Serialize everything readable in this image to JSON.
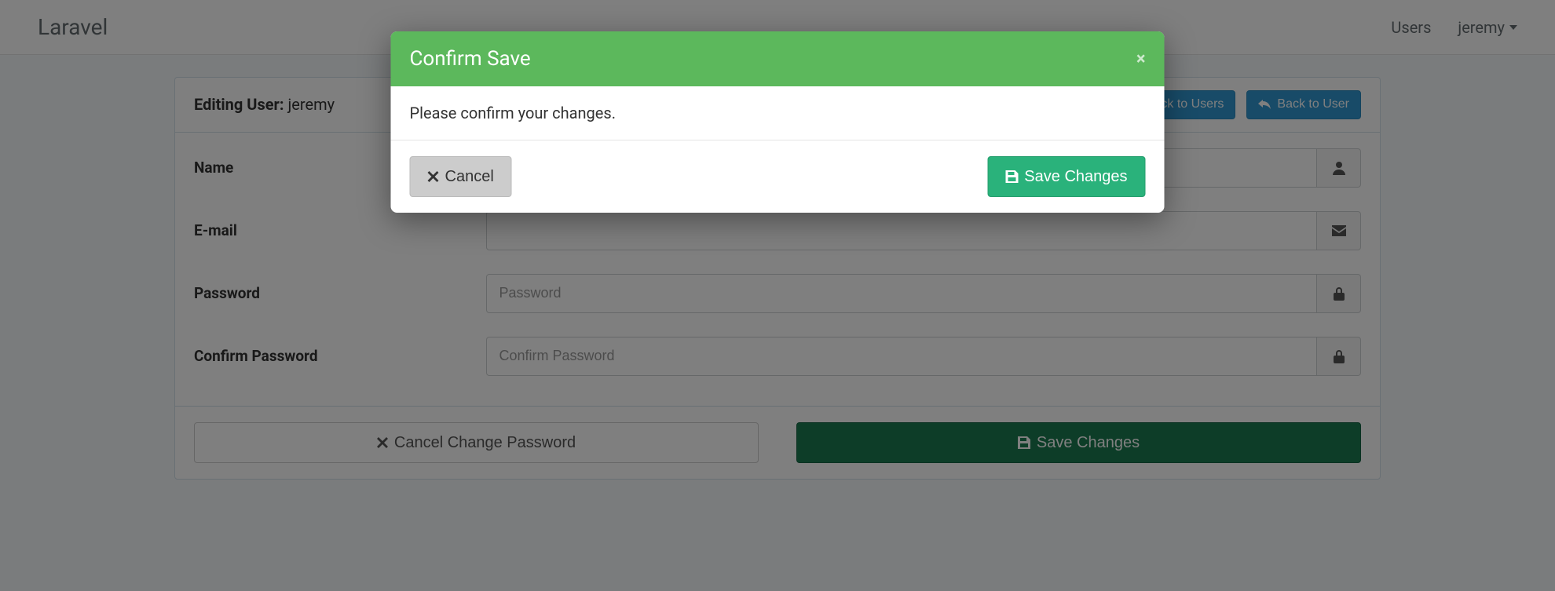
{
  "nav": {
    "brand": "Laravel",
    "users_link": "Users",
    "current_user": "jeremy"
  },
  "panel": {
    "heading_prefix": "Editing User:",
    "heading_user": "jeremy",
    "back_to_users": "Back to Users",
    "back_to_user": "Back to User"
  },
  "form": {
    "name_label": "Name",
    "name_value": "",
    "email_label": "E-mail",
    "email_value": "",
    "password_label": "Password",
    "password_placeholder": "Password",
    "confirm_password_label": "Confirm Password",
    "confirm_password_placeholder": "Confirm Password"
  },
  "footer": {
    "cancel_change_password": "Cancel Change Password",
    "save_changes": "Save Changes"
  },
  "modal": {
    "title": "Confirm Save",
    "body": "Please confirm your changes.",
    "cancel": "Cancel",
    "save": "Save Changes",
    "close_symbol": "×"
  }
}
